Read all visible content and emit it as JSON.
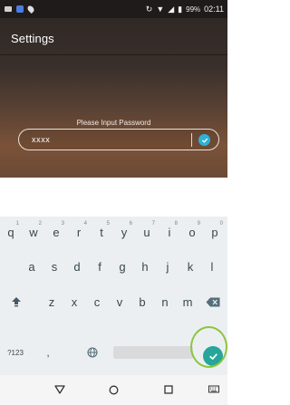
{
  "status_bar": {
    "battery_percent": "99%",
    "time": "02:11"
  },
  "header": {
    "title": "Settings"
  },
  "password": {
    "prompt": "Please Input Password",
    "value": "xxxx"
  },
  "keyboard": {
    "row1": [
      {
        "key": "q",
        "hint": "1"
      },
      {
        "key": "w",
        "hint": "2"
      },
      {
        "key": "e",
        "hint": "3"
      },
      {
        "key": "r",
        "hint": "4"
      },
      {
        "key": "t",
        "hint": "5"
      },
      {
        "key": "y",
        "hint": "6"
      },
      {
        "key": "u",
        "hint": "7"
      },
      {
        "key": "i",
        "hint": "8"
      },
      {
        "key": "o",
        "hint": "9"
      },
      {
        "key": "p",
        "hint": "0"
      }
    ],
    "row2": [
      "a",
      "s",
      "d",
      "f",
      "g",
      "h",
      "j",
      "k",
      "l"
    ],
    "row3": [
      "z",
      "x",
      "c",
      "v",
      "b",
      "n",
      "m"
    ],
    "symbols_key": "?123",
    "comma_key": ",",
    "enter_icon": "check-icon",
    "shift_icon": "shift-icon",
    "backspace_icon": "backspace-icon",
    "language_icon": "globe-icon"
  },
  "nav": {
    "back_icon": "back-triangle-icon",
    "home_icon": "home-circle-icon",
    "recents_icon": "recents-square-icon",
    "keyboard_icon": "keyboard-icon"
  },
  "colors": {
    "accent": "#2fb1d6",
    "enter": "#26a69a",
    "highlight": "#8cc63e"
  }
}
